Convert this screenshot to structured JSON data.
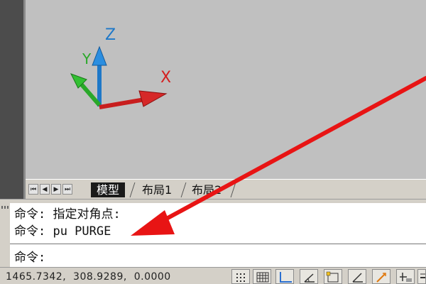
{
  "axes": {
    "z_label": "Z",
    "y_label": "Y",
    "x_label": "X"
  },
  "tabs": [
    {
      "label": "模型",
      "active": true
    },
    {
      "label": "布局1",
      "active": false
    },
    {
      "label": "布局2",
      "active": false
    }
  ],
  "command": {
    "history": [
      "命令: 指定对角点:",
      "命令: pu PURGE"
    ],
    "prompt": "命令:"
  },
  "status": {
    "coordinates": "1465.7342,  308.9289,  0.0000"
  },
  "status_buttons": [
    "snap-toggle-button",
    "grid-toggle-button",
    "ortho-toggle-button",
    "polar-toggle-button",
    "object-snap-button",
    "object-track-button",
    "ducs-button",
    "dyn-input-button",
    "lineweight-button"
  ],
  "colors": {
    "viewport_bg": "#c0c0c0",
    "axis_z": "#1e78c8",
    "axis_y": "#2aa82a",
    "axis_x": "#c81e1e",
    "annotation_arrow": "#e81414"
  }
}
